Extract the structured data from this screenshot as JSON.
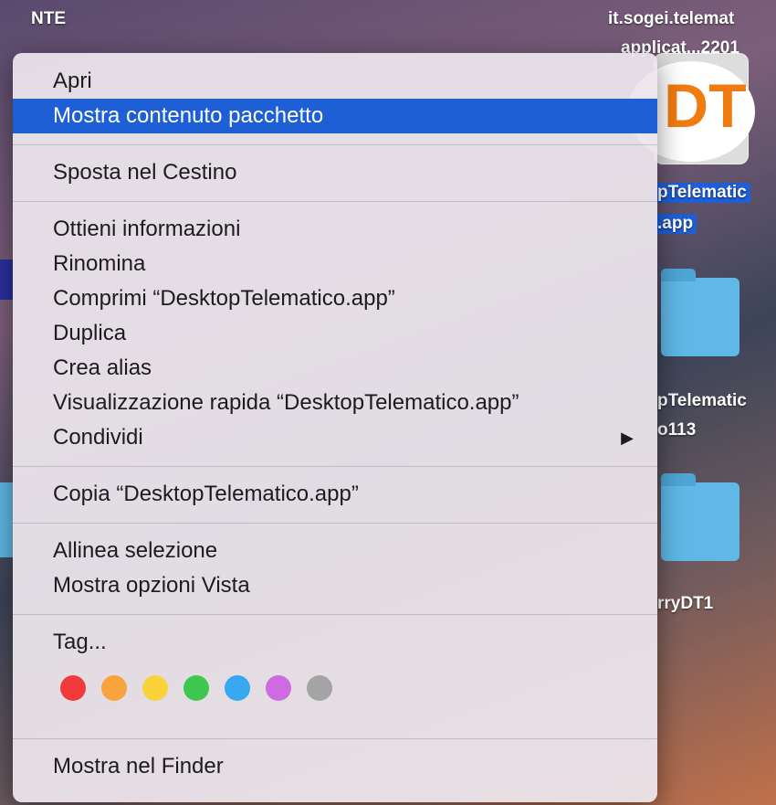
{
  "desktop": {
    "labels": {
      "top_left": "NTE",
      "top_right_line1": "it.sogei.telemat",
      "top_right_line2": "applicat...2201",
      "app_line1": "pTelematic",
      "app_line2": ".app",
      "folder1_line1": "pTelematic",
      "folder1_line2": "o113",
      "folder2_line1": "rryDT1"
    },
    "app_icon_text": "DT",
    "folder_color": "#5fb8e6"
  },
  "menu": {
    "highlight_color": "#1f5fd6",
    "groups": [
      [
        "Apri",
        "Mostra contenuto pacchetto"
      ],
      [
        "Sposta nel Cestino"
      ],
      [
        "Ottieni informazioni",
        "Rinomina",
        "Comprimi “DesktopTelematico.app”",
        "Duplica",
        "Crea alias",
        "Visualizzazione rapida “DesktopTelematico.app”",
        "Condividi"
      ],
      [
        "Copia “DesktopTelematico.app”"
      ],
      [
        "Allinea selezione",
        "Mostra opzioni Vista"
      ],
      [
        "Tag..."
      ],
      [
        "Mostra nel Finder"
      ]
    ],
    "submenu_arrow": "▶",
    "tag_colors": [
      {
        "name": "red",
        "hex": "#f23a3a"
      },
      {
        "name": "orange",
        "hex": "#f9a33c"
      },
      {
        "name": "yellow",
        "hex": "#f8d43a"
      },
      {
        "name": "green",
        "hex": "#3ec74e"
      },
      {
        "name": "blue",
        "hex": "#35a8f0"
      },
      {
        "name": "purple",
        "hex": "#cf6be0"
      },
      {
        "name": "gray",
        "hex": "#a4a4a4"
      }
    ]
  }
}
